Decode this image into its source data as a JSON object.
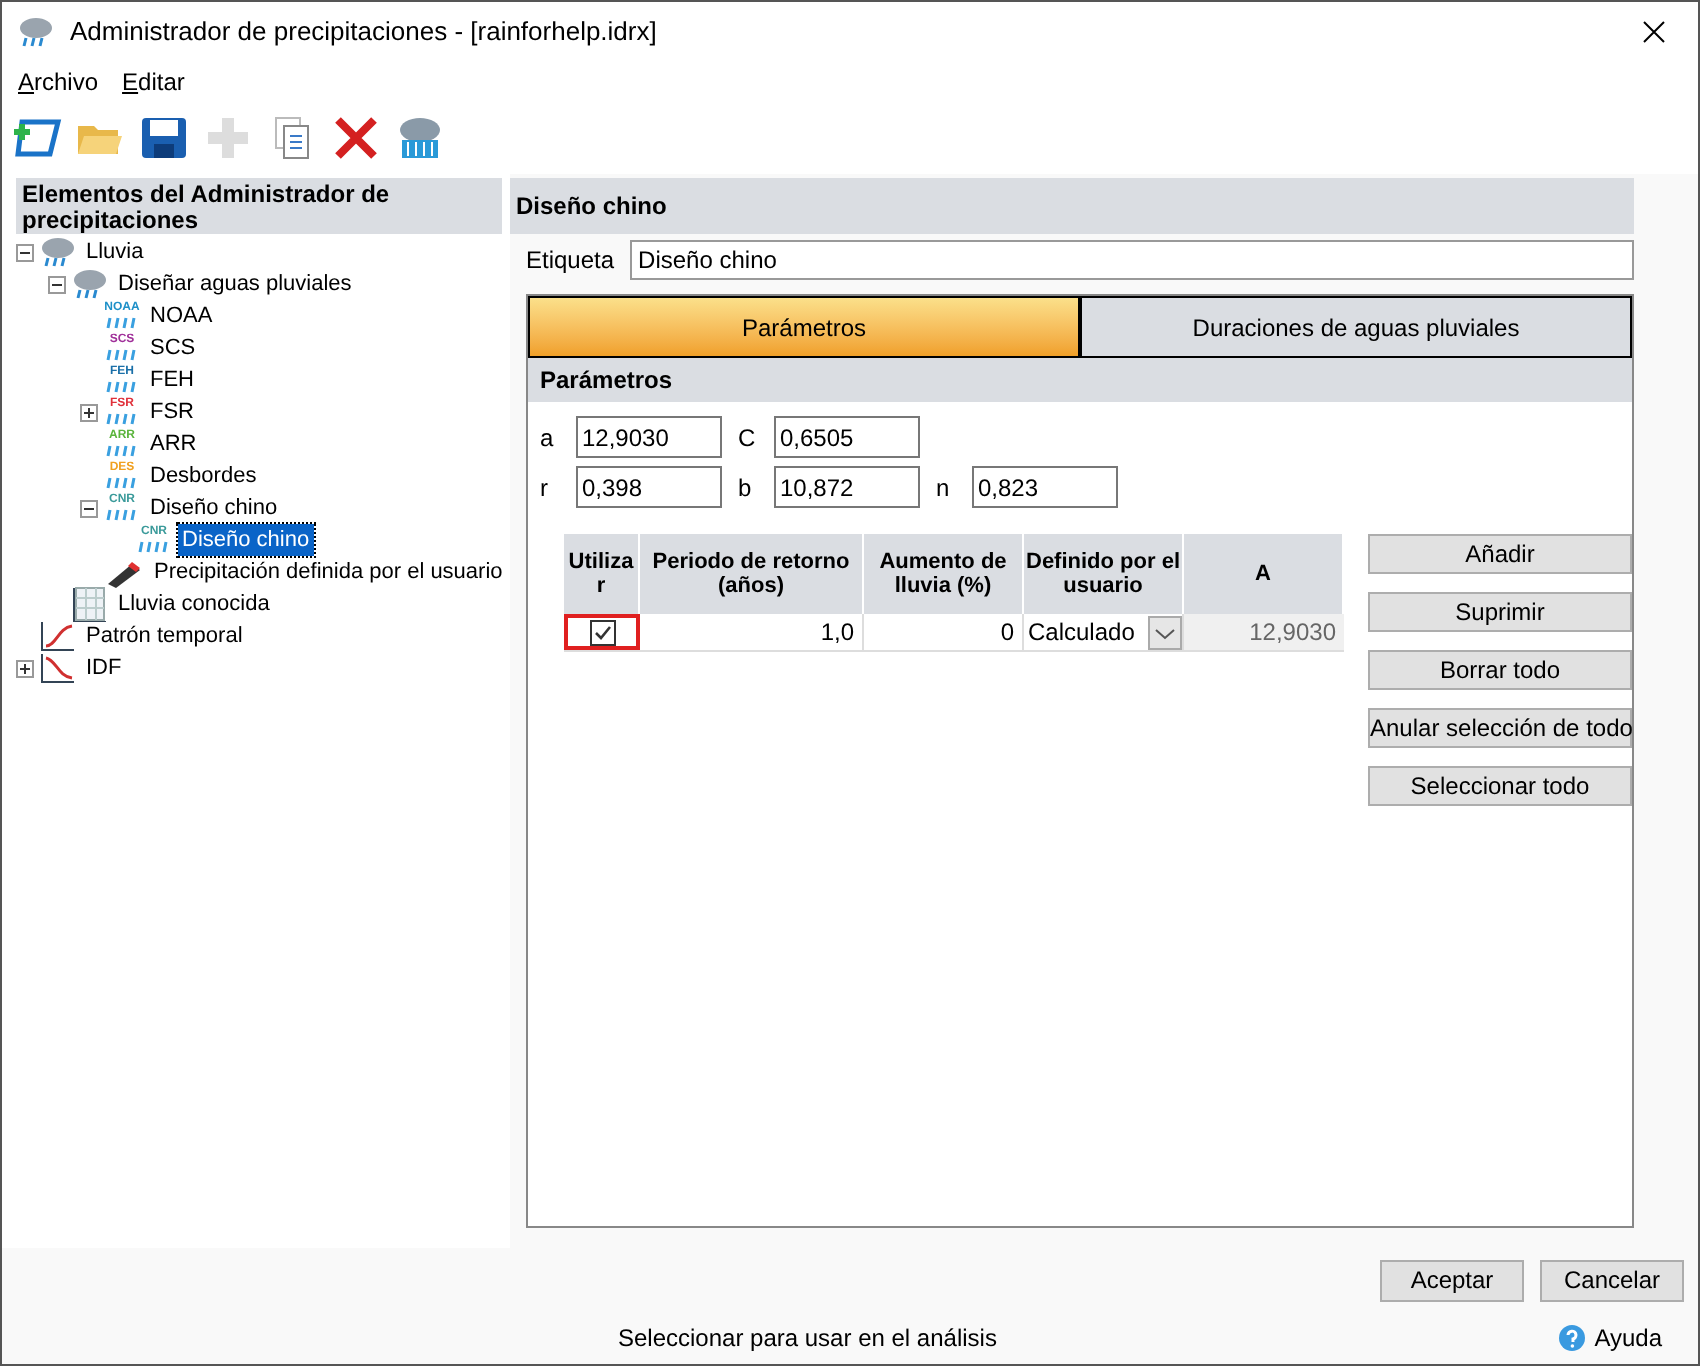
{
  "window": {
    "title": "Administrador de precipitaciones - [rainforhelp.idrx]"
  },
  "menu": [
    "Archivo",
    "Editar"
  ],
  "toolbar": [
    {
      "kind": "new",
      "disabled": false
    },
    {
      "kind": "open",
      "disabled": false
    },
    {
      "kind": "save",
      "disabled": false
    },
    {
      "kind": "add",
      "disabled": true
    },
    {
      "kind": "copy",
      "disabled": false
    },
    {
      "kind": "delete",
      "disabled": false
    },
    {
      "kind": "rain",
      "disabled": false
    }
  ],
  "tree": {
    "title": "Elementos del Administrador de precipitaciones",
    "items": [
      {
        "label": "Lluvia",
        "kind": "cloud",
        "expanded": true,
        "selected": false,
        "children": [
          {
            "label": "Diseñar aguas pluviales",
            "kind": "cloud",
            "expanded": true,
            "selected": false,
            "children": [
              {
                "label": "NOAA",
                "kind": "badge",
                "badge": "NOAA",
                "color": "#1e90c8",
                "selected": false
              },
              {
                "label": "SCS",
                "kind": "badge",
                "badge": "SCS",
                "color": "#a0309a",
                "selected": false
              },
              {
                "label": "FEH",
                "kind": "badge",
                "badge": "FEH",
                "color": "#1a6fa8",
                "selected": false
              },
              {
                "label": "FSR",
                "kind": "badge",
                "badge": "FSR",
                "color": "#e0303a",
                "expanded": false,
                "selected": false
              },
              {
                "label": "ARR",
                "kind": "badge",
                "badge": "ARR",
                "color": "#5ab43c",
                "selected": false
              },
              {
                "label": "Desbordes",
                "kind": "badge",
                "badge": "DES",
                "color": "#f0a020",
                "selected": false
              },
              {
                "label": "Diseño chino",
                "kind": "badge",
                "badge": "CNR",
                "color": "#3a9a9a",
                "expanded": true,
                "selected": false,
                "children": [
                  {
                    "label": "Diseño chino",
                    "kind": "badge",
                    "badge": "CNR",
                    "color": "#3a9a9a",
                    "selected": true
                  }
                ]
              },
              {
                "label": "Precipitación definida por el usuario",
                "kind": "pencil",
                "selected": false
              }
            ]
          },
          {
            "label": "Lluvia conocida",
            "kind": "grid",
            "selected": false
          }
        ]
      },
      {
        "label": "Patrón temporal",
        "kind": "curve-up",
        "selected": false
      },
      {
        "label": "IDF",
        "kind": "curve-down",
        "expanded": false,
        "selected": false
      }
    ]
  },
  "panel": {
    "title": "Diseño chino",
    "label_caption": "Etiqueta",
    "label_value": "Diseño chino",
    "tabs": [
      {
        "label": "Parámetros",
        "selected": true
      },
      {
        "label": "Duraciones de aguas pluviales",
        "selected": false
      }
    ],
    "section": "Parámetros",
    "params": [
      [
        {
          "name": "a",
          "value": "12,9030"
        },
        {
          "name": "C",
          "value": "0,6505"
        }
      ],
      [
        {
          "name": "r",
          "value": "0,398"
        },
        {
          "name": "b",
          "value": "10,872"
        },
        {
          "name": "n",
          "value": "0,823"
        }
      ]
    ],
    "table": {
      "columns": [
        "Utiliza r",
        "Periodo de retorno (años)",
        "Aumento de lluvia (%)",
        "Definido por el usuario",
        "A"
      ],
      "rows": [
        {
          "checked": true,
          "period": "1,0",
          "increase": "0",
          "defined": "Calculado",
          "a": "12,9030"
        }
      ]
    },
    "buttons": [
      "Añadir",
      "Suprimir",
      "Borrar todo",
      "Anular selección de todo",
      "Seleccionar todo"
    ]
  },
  "footer": {
    "buttons": [
      "Aceptar",
      "Cancelar"
    ],
    "status": "Seleccionar para usar en el análisis",
    "help": "Ayuda"
  }
}
